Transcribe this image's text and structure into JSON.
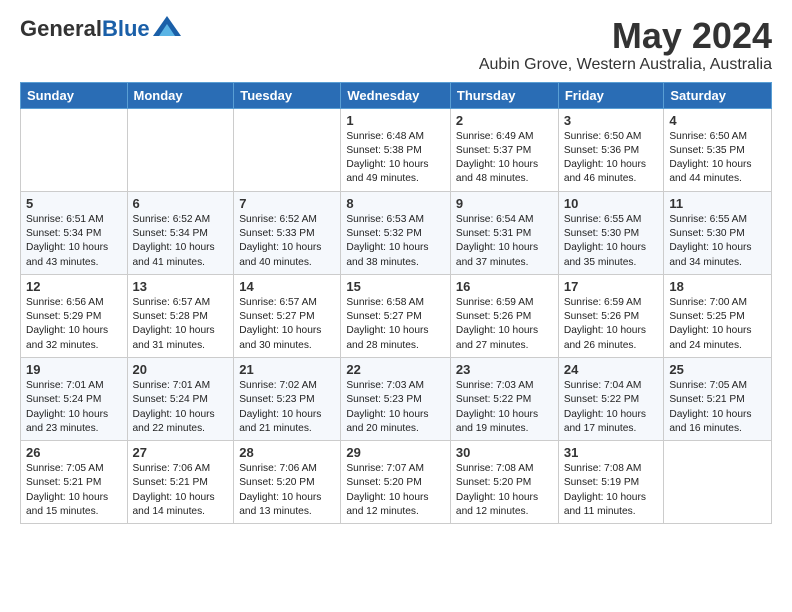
{
  "header": {
    "logo_general": "General",
    "logo_blue": "Blue",
    "title": "May 2024",
    "subtitle": "Aubin Grove, Western Australia, Australia"
  },
  "weekdays": [
    "Sunday",
    "Monday",
    "Tuesday",
    "Wednesday",
    "Thursday",
    "Friday",
    "Saturday"
  ],
  "weeks": [
    [
      {
        "day": "",
        "info": ""
      },
      {
        "day": "",
        "info": ""
      },
      {
        "day": "",
        "info": ""
      },
      {
        "day": "1",
        "info": "Sunrise: 6:48 AM\nSunset: 5:38 PM\nDaylight: 10 hours\nand 49 minutes."
      },
      {
        "day": "2",
        "info": "Sunrise: 6:49 AM\nSunset: 5:37 PM\nDaylight: 10 hours\nand 48 minutes."
      },
      {
        "day": "3",
        "info": "Sunrise: 6:50 AM\nSunset: 5:36 PM\nDaylight: 10 hours\nand 46 minutes."
      },
      {
        "day": "4",
        "info": "Sunrise: 6:50 AM\nSunset: 5:35 PM\nDaylight: 10 hours\nand 44 minutes."
      }
    ],
    [
      {
        "day": "5",
        "info": "Sunrise: 6:51 AM\nSunset: 5:34 PM\nDaylight: 10 hours\nand 43 minutes."
      },
      {
        "day": "6",
        "info": "Sunrise: 6:52 AM\nSunset: 5:34 PM\nDaylight: 10 hours\nand 41 minutes."
      },
      {
        "day": "7",
        "info": "Sunrise: 6:52 AM\nSunset: 5:33 PM\nDaylight: 10 hours\nand 40 minutes."
      },
      {
        "day": "8",
        "info": "Sunrise: 6:53 AM\nSunset: 5:32 PM\nDaylight: 10 hours\nand 38 minutes."
      },
      {
        "day": "9",
        "info": "Sunrise: 6:54 AM\nSunset: 5:31 PM\nDaylight: 10 hours\nand 37 minutes."
      },
      {
        "day": "10",
        "info": "Sunrise: 6:55 AM\nSunset: 5:30 PM\nDaylight: 10 hours\nand 35 minutes."
      },
      {
        "day": "11",
        "info": "Sunrise: 6:55 AM\nSunset: 5:30 PM\nDaylight: 10 hours\nand 34 minutes."
      }
    ],
    [
      {
        "day": "12",
        "info": "Sunrise: 6:56 AM\nSunset: 5:29 PM\nDaylight: 10 hours\nand 32 minutes."
      },
      {
        "day": "13",
        "info": "Sunrise: 6:57 AM\nSunset: 5:28 PM\nDaylight: 10 hours\nand 31 minutes."
      },
      {
        "day": "14",
        "info": "Sunrise: 6:57 AM\nSunset: 5:27 PM\nDaylight: 10 hours\nand 30 minutes."
      },
      {
        "day": "15",
        "info": "Sunrise: 6:58 AM\nSunset: 5:27 PM\nDaylight: 10 hours\nand 28 minutes."
      },
      {
        "day": "16",
        "info": "Sunrise: 6:59 AM\nSunset: 5:26 PM\nDaylight: 10 hours\nand 27 minutes."
      },
      {
        "day": "17",
        "info": "Sunrise: 6:59 AM\nSunset: 5:26 PM\nDaylight: 10 hours\nand 26 minutes."
      },
      {
        "day": "18",
        "info": "Sunrise: 7:00 AM\nSunset: 5:25 PM\nDaylight: 10 hours\nand 24 minutes."
      }
    ],
    [
      {
        "day": "19",
        "info": "Sunrise: 7:01 AM\nSunset: 5:24 PM\nDaylight: 10 hours\nand 23 minutes."
      },
      {
        "day": "20",
        "info": "Sunrise: 7:01 AM\nSunset: 5:24 PM\nDaylight: 10 hours\nand 22 minutes."
      },
      {
        "day": "21",
        "info": "Sunrise: 7:02 AM\nSunset: 5:23 PM\nDaylight: 10 hours\nand 21 minutes."
      },
      {
        "day": "22",
        "info": "Sunrise: 7:03 AM\nSunset: 5:23 PM\nDaylight: 10 hours\nand 20 minutes."
      },
      {
        "day": "23",
        "info": "Sunrise: 7:03 AM\nSunset: 5:22 PM\nDaylight: 10 hours\nand 19 minutes."
      },
      {
        "day": "24",
        "info": "Sunrise: 7:04 AM\nSunset: 5:22 PM\nDaylight: 10 hours\nand 17 minutes."
      },
      {
        "day": "25",
        "info": "Sunrise: 7:05 AM\nSunset: 5:21 PM\nDaylight: 10 hours\nand 16 minutes."
      }
    ],
    [
      {
        "day": "26",
        "info": "Sunrise: 7:05 AM\nSunset: 5:21 PM\nDaylight: 10 hours\nand 15 minutes."
      },
      {
        "day": "27",
        "info": "Sunrise: 7:06 AM\nSunset: 5:21 PM\nDaylight: 10 hours\nand 14 minutes."
      },
      {
        "day": "28",
        "info": "Sunrise: 7:06 AM\nSunset: 5:20 PM\nDaylight: 10 hours\nand 13 minutes."
      },
      {
        "day": "29",
        "info": "Sunrise: 7:07 AM\nSunset: 5:20 PM\nDaylight: 10 hours\nand 12 minutes."
      },
      {
        "day": "30",
        "info": "Sunrise: 7:08 AM\nSunset: 5:20 PM\nDaylight: 10 hours\nand 12 minutes."
      },
      {
        "day": "31",
        "info": "Sunrise: 7:08 AM\nSunset: 5:19 PM\nDaylight: 10 hours\nand 11 minutes."
      },
      {
        "day": "",
        "info": ""
      }
    ]
  ]
}
